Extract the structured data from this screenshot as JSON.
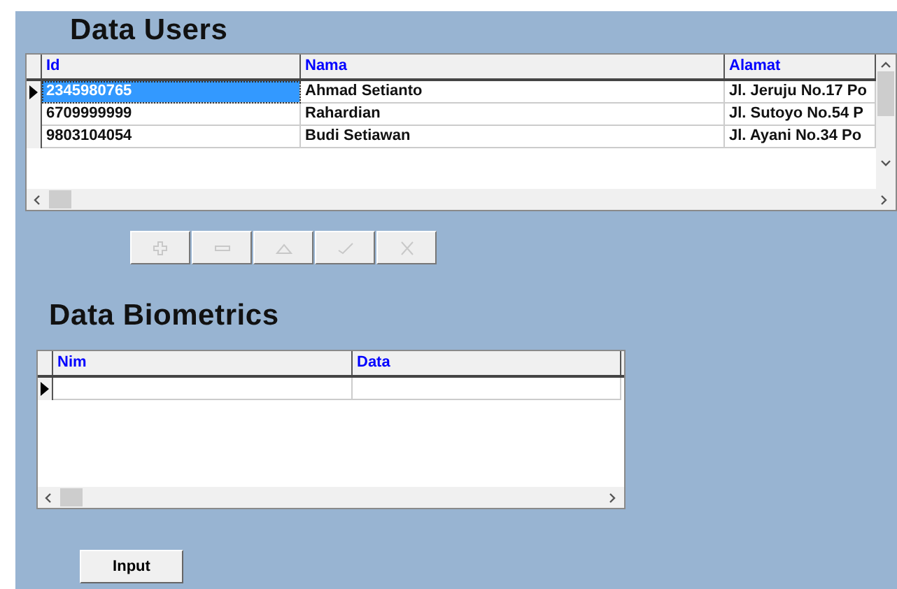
{
  "users": {
    "title": "Data Users",
    "columns": [
      "Id",
      "Nama",
      "Alamat"
    ],
    "rows": [
      {
        "cells": [
          "2345980765",
          "Ahmad Setianto",
          "Jl. Jeruju No.17 Po"
        ],
        "selected": true
      },
      {
        "cells": [
          "6709999999",
          "Rahardian",
          "Jl. Sutoyo No.54 P"
        ],
        "selected": false
      },
      {
        "cells": [
          "9803104054",
          "Budi Setiawan",
          "Jl. Ayani No.34 Po"
        ],
        "selected": false
      }
    ]
  },
  "navigator": [
    {
      "kind": "insert",
      "disabled": true
    },
    {
      "kind": "delete",
      "disabled": true
    },
    {
      "kind": "edit",
      "disabled": true
    },
    {
      "kind": "post",
      "disabled": true
    },
    {
      "kind": "cancel",
      "disabled": true
    }
  ],
  "biometrics": {
    "title": "Data Biometrics",
    "columns": [
      "Nim",
      "Data"
    ],
    "rows": [
      {
        "cells": [
          "",
          ""
        ],
        "selected": true
      }
    ]
  },
  "input_button": {
    "label": "Input"
  }
}
